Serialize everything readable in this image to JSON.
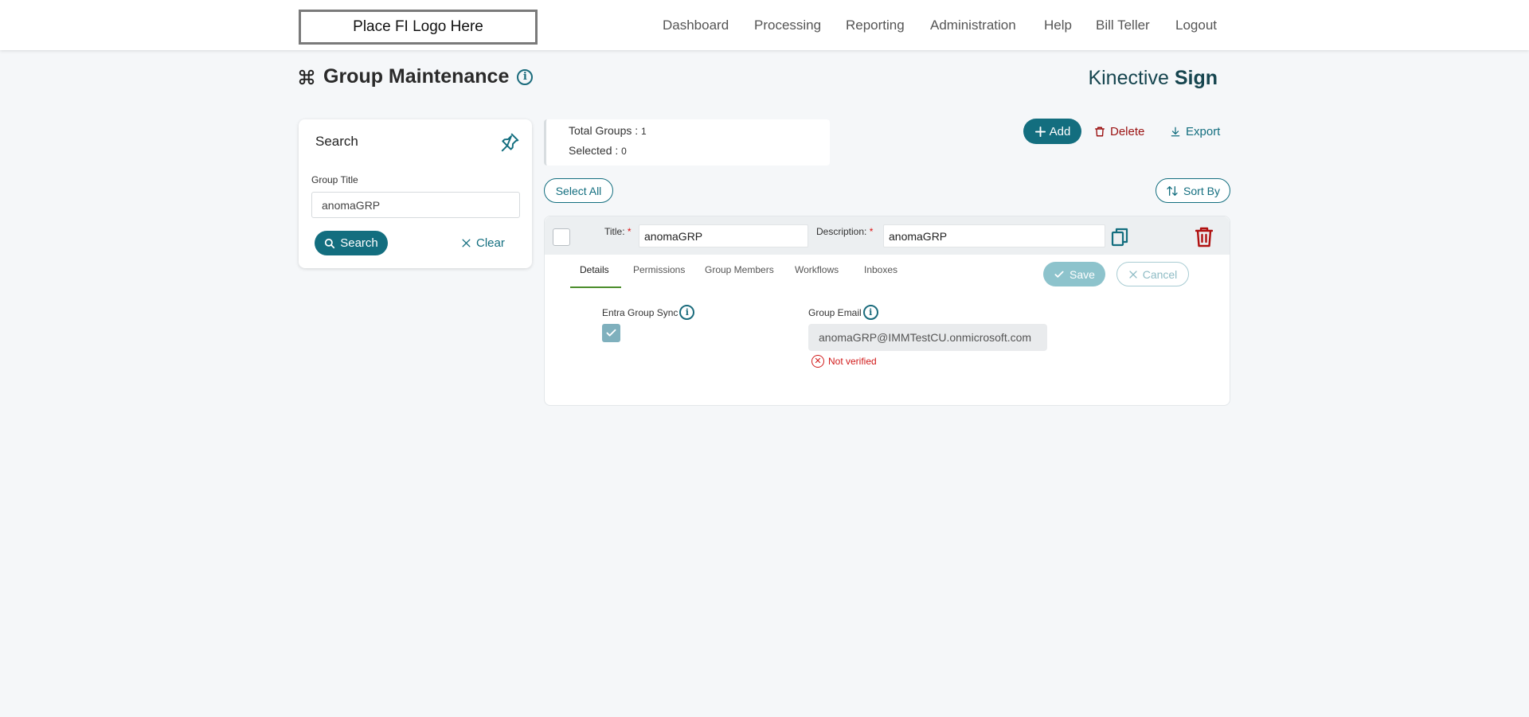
{
  "header": {
    "logo_text": "Place FI Logo Here",
    "nav": [
      "Dashboard",
      "Processing",
      "Reporting",
      "Administration",
      "Help",
      "Bill Teller",
      "Logout"
    ]
  },
  "page": {
    "title": "Group Maintenance",
    "brand_light": "Kinective ",
    "brand_bold": "Sign"
  },
  "search": {
    "header": "Search",
    "field_label": "Group Title",
    "field_value": "anomaGRP",
    "search_label": "Search",
    "clear_label": "Clear"
  },
  "summary": {
    "total_label": "Total Groups : ",
    "total_value": "1",
    "selected_label": "Selected : ",
    "selected_value": "0"
  },
  "toolbar": {
    "add_label": "Add",
    "delete_label": "Delete",
    "export_label": "Export",
    "select_all_label": "Select All",
    "sort_by_label": "Sort By"
  },
  "group": {
    "title_label": "Title:",
    "title_value": "anomaGRP",
    "description_label": "Description:",
    "description_value": "anomaGRP",
    "tabs": [
      "Details",
      "Permissions",
      "Group Members",
      "Workflows",
      "Inboxes"
    ],
    "active_tab": "Details",
    "save_label": "Save",
    "cancel_label": "Cancel",
    "sync_label": "Entra Group Sync",
    "sync_checked": true,
    "email_label": "Group Email",
    "email_value": "anomaGRP@IMMTestCU.onmicrosoft.com",
    "verification_status": "Not verified"
  },
  "colors": {
    "primary": "#136e7f",
    "danger": "#9b1212",
    "error": "#d11a1a",
    "tab_active_underline": "#4a8c2a"
  }
}
